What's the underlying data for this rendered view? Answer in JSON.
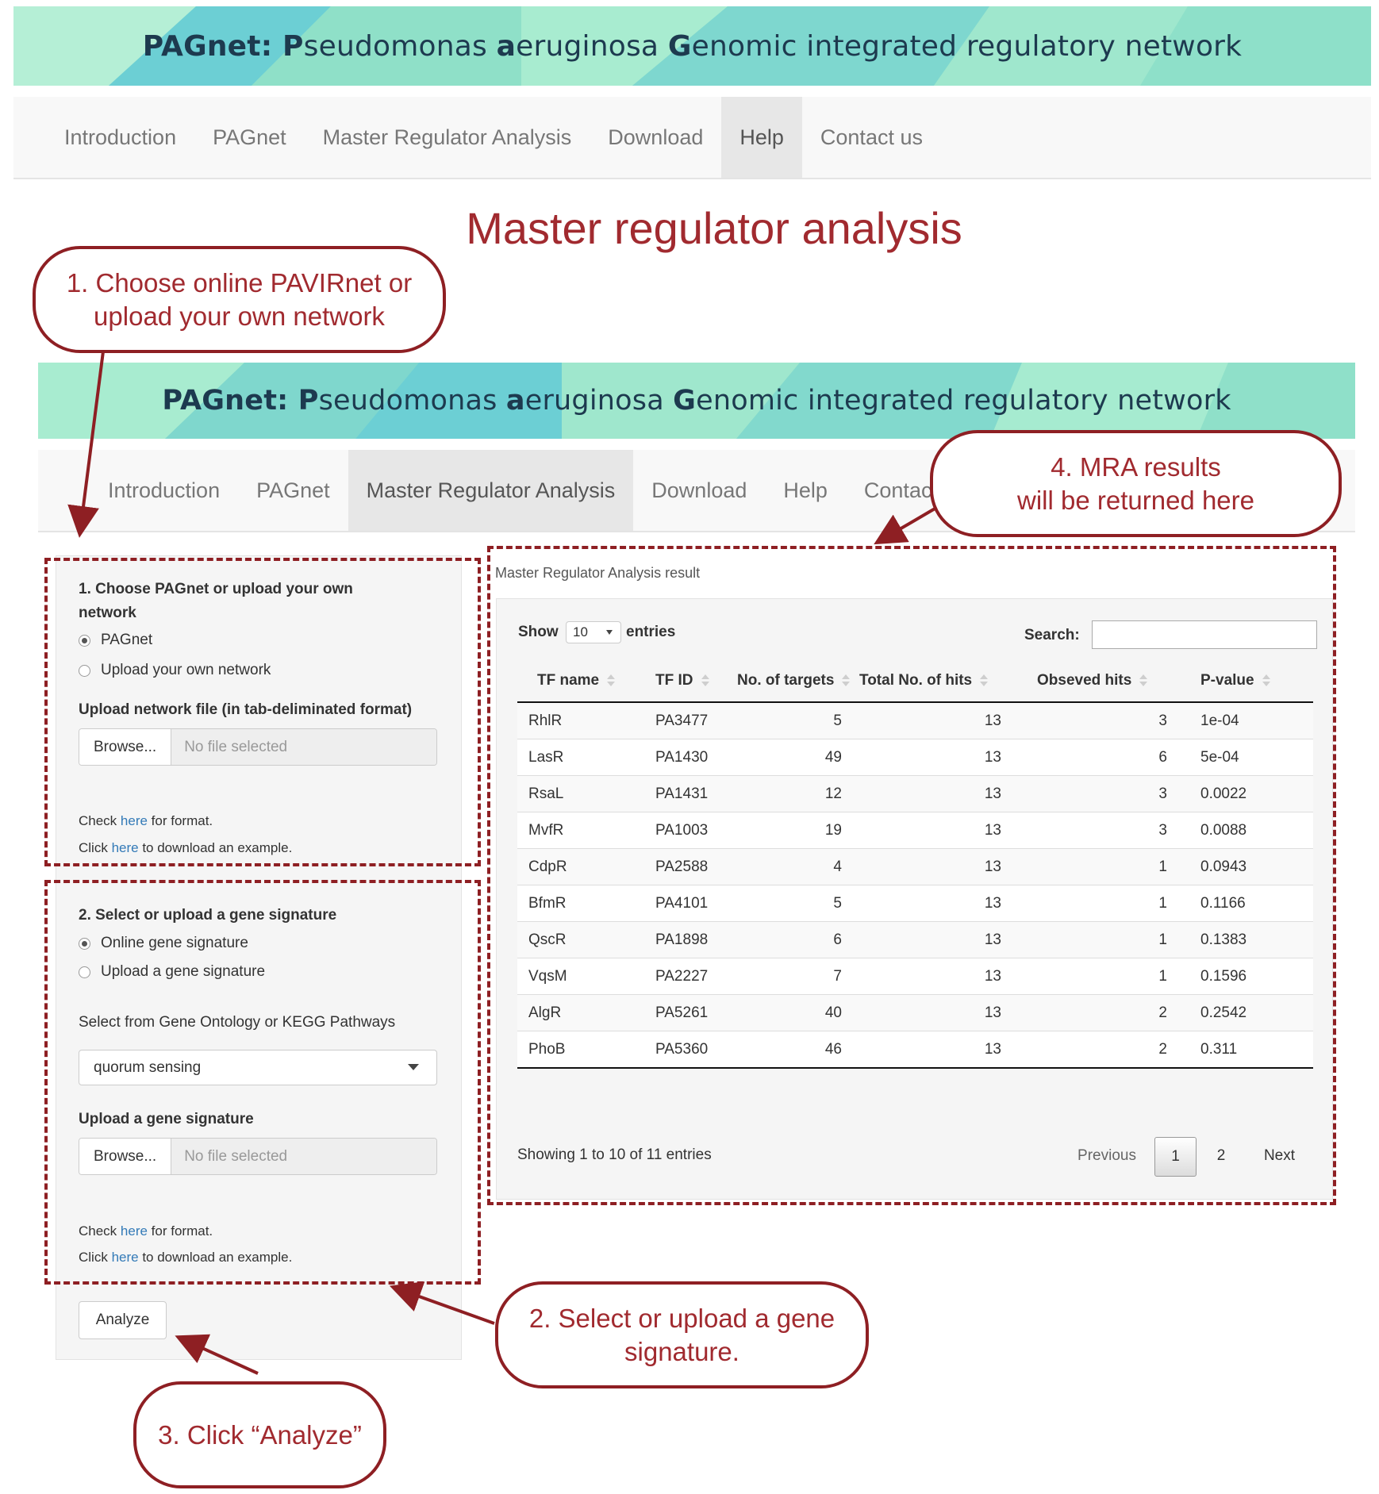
{
  "banner": {
    "parts": [
      {
        "bold": "PAGnet: ",
        "normal": ""
      },
      {
        "bold": "P",
        "normal": "seudomonas "
      },
      {
        "bold": "a",
        "normal": "eruginosa "
      },
      {
        "bold": "G",
        "normal": "enomic integrated regulatory network"
      }
    ],
    "colors": {
      "light": "#a8ecd0",
      "mid": "#86dcc8",
      "dark": "#6ccfd4",
      "title": "#1d3a4f"
    }
  },
  "nav_top": [
    "Introduction",
    "PAGnet",
    "Master Regulator Analysis",
    "Download",
    "Help",
    "Contact us"
  ],
  "nav_top_active": "Help",
  "nav_inner": [
    "Introduction",
    "PAGnet",
    "Master Regulator Analysis",
    "Download",
    "Help",
    "Contact us"
  ],
  "nav_inner_active": "Master Regulator Analysis",
  "page_title": "Master regulator analysis",
  "callouts": {
    "c1": [
      "1. Choose online PAVIRnet or",
      "upload your own network"
    ],
    "c2": [
      "2. Select or upload a gene",
      "signature."
    ],
    "c3": [
      "3. Click “Analyze”"
    ],
    "c4": [
      "4. MRA results",
      "will be returned here"
    ]
  },
  "form": {
    "section1_title": "1. Choose PAGnet or upload your own network",
    "network_options": [
      "PAGnet",
      "Upload your own network"
    ],
    "network_selected": 0,
    "upload_network_label": "Upload network file (in tab-deliminated format)",
    "browse_label": "Browse...",
    "no_file": "No file selected",
    "check_pre": "Check ",
    "here": "here",
    "check_post": " for format.",
    "click_pre": "Click ",
    "click_post": " to download an example.",
    "section2_title": "2. Select or upload a gene signature",
    "signature_options": [
      "Online gene signature",
      "Upload a gene signature"
    ],
    "signature_selected": 0,
    "select_label": "Select from Gene Ontology or KEGG Pathways",
    "select_value": "quorum sensing",
    "upload_signature_label": "Upload a gene signature",
    "analyze_label": "Analyze"
  },
  "result": {
    "title": "Master Regulator Analysis result",
    "show": "Show",
    "entries_value": "10",
    "entries": "entries",
    "search_label": "Search:",
    "columns": [
      "TF name",
      "TF ID",
      "No. of targets",
      "Total No. of hits",
      "Obseved hits",
      "P-value"
    ],
    "rows": [
      [
        "RhlR",
        "PA3477",
        "5",
        "13",
        "3",
        "1e-04"
      ],
      [
        "LasR",
        "PA1430",
        "49",
        "13",
        "6",
        "5e-04"
      ],
      [
        "RsaL",
        "PA1431",
        "12",
        "13",
        "3",
        "0.0022"
      ],
      [
        "MvfR",
        "PA1003",
        "19",
        "13",
        "3",
        "0.0088"
      ],
      [
        "CdpR",
        "PA2588",
        "4",
        "13",
        "1",
        "0.0943"
      ],
      [
        "BfmR",
        "PA4101",
        "5",
        "13",
        "1",
        "0.1166"
      ],
      [
        "QscR",
        "PA1898",
        "6",
        "13",
        "1",
        "0.1383"
      ],
      [
        "VqsM",
        "PA2227",
        "7",
        "13",
        "1",
        "0.1596"
      ],
      [
        "AlgR",
        "PA5261",
        "40",
        "13",
        "2",
        "0.2542"
      ],
      [
        "PhoB",
        "PA5360",
        "46",
        "13",
        "2",
        "0.311"
      ]
    ],
    "info": "Showing 1 to 10 of 11 entries",
    "previous": "Previous",
    "pages": [
      "1",
      "2"
    ],
    "current_page": "1",
    "next": "Next"
  },
  "accent_color": "#8e1f23"
}
